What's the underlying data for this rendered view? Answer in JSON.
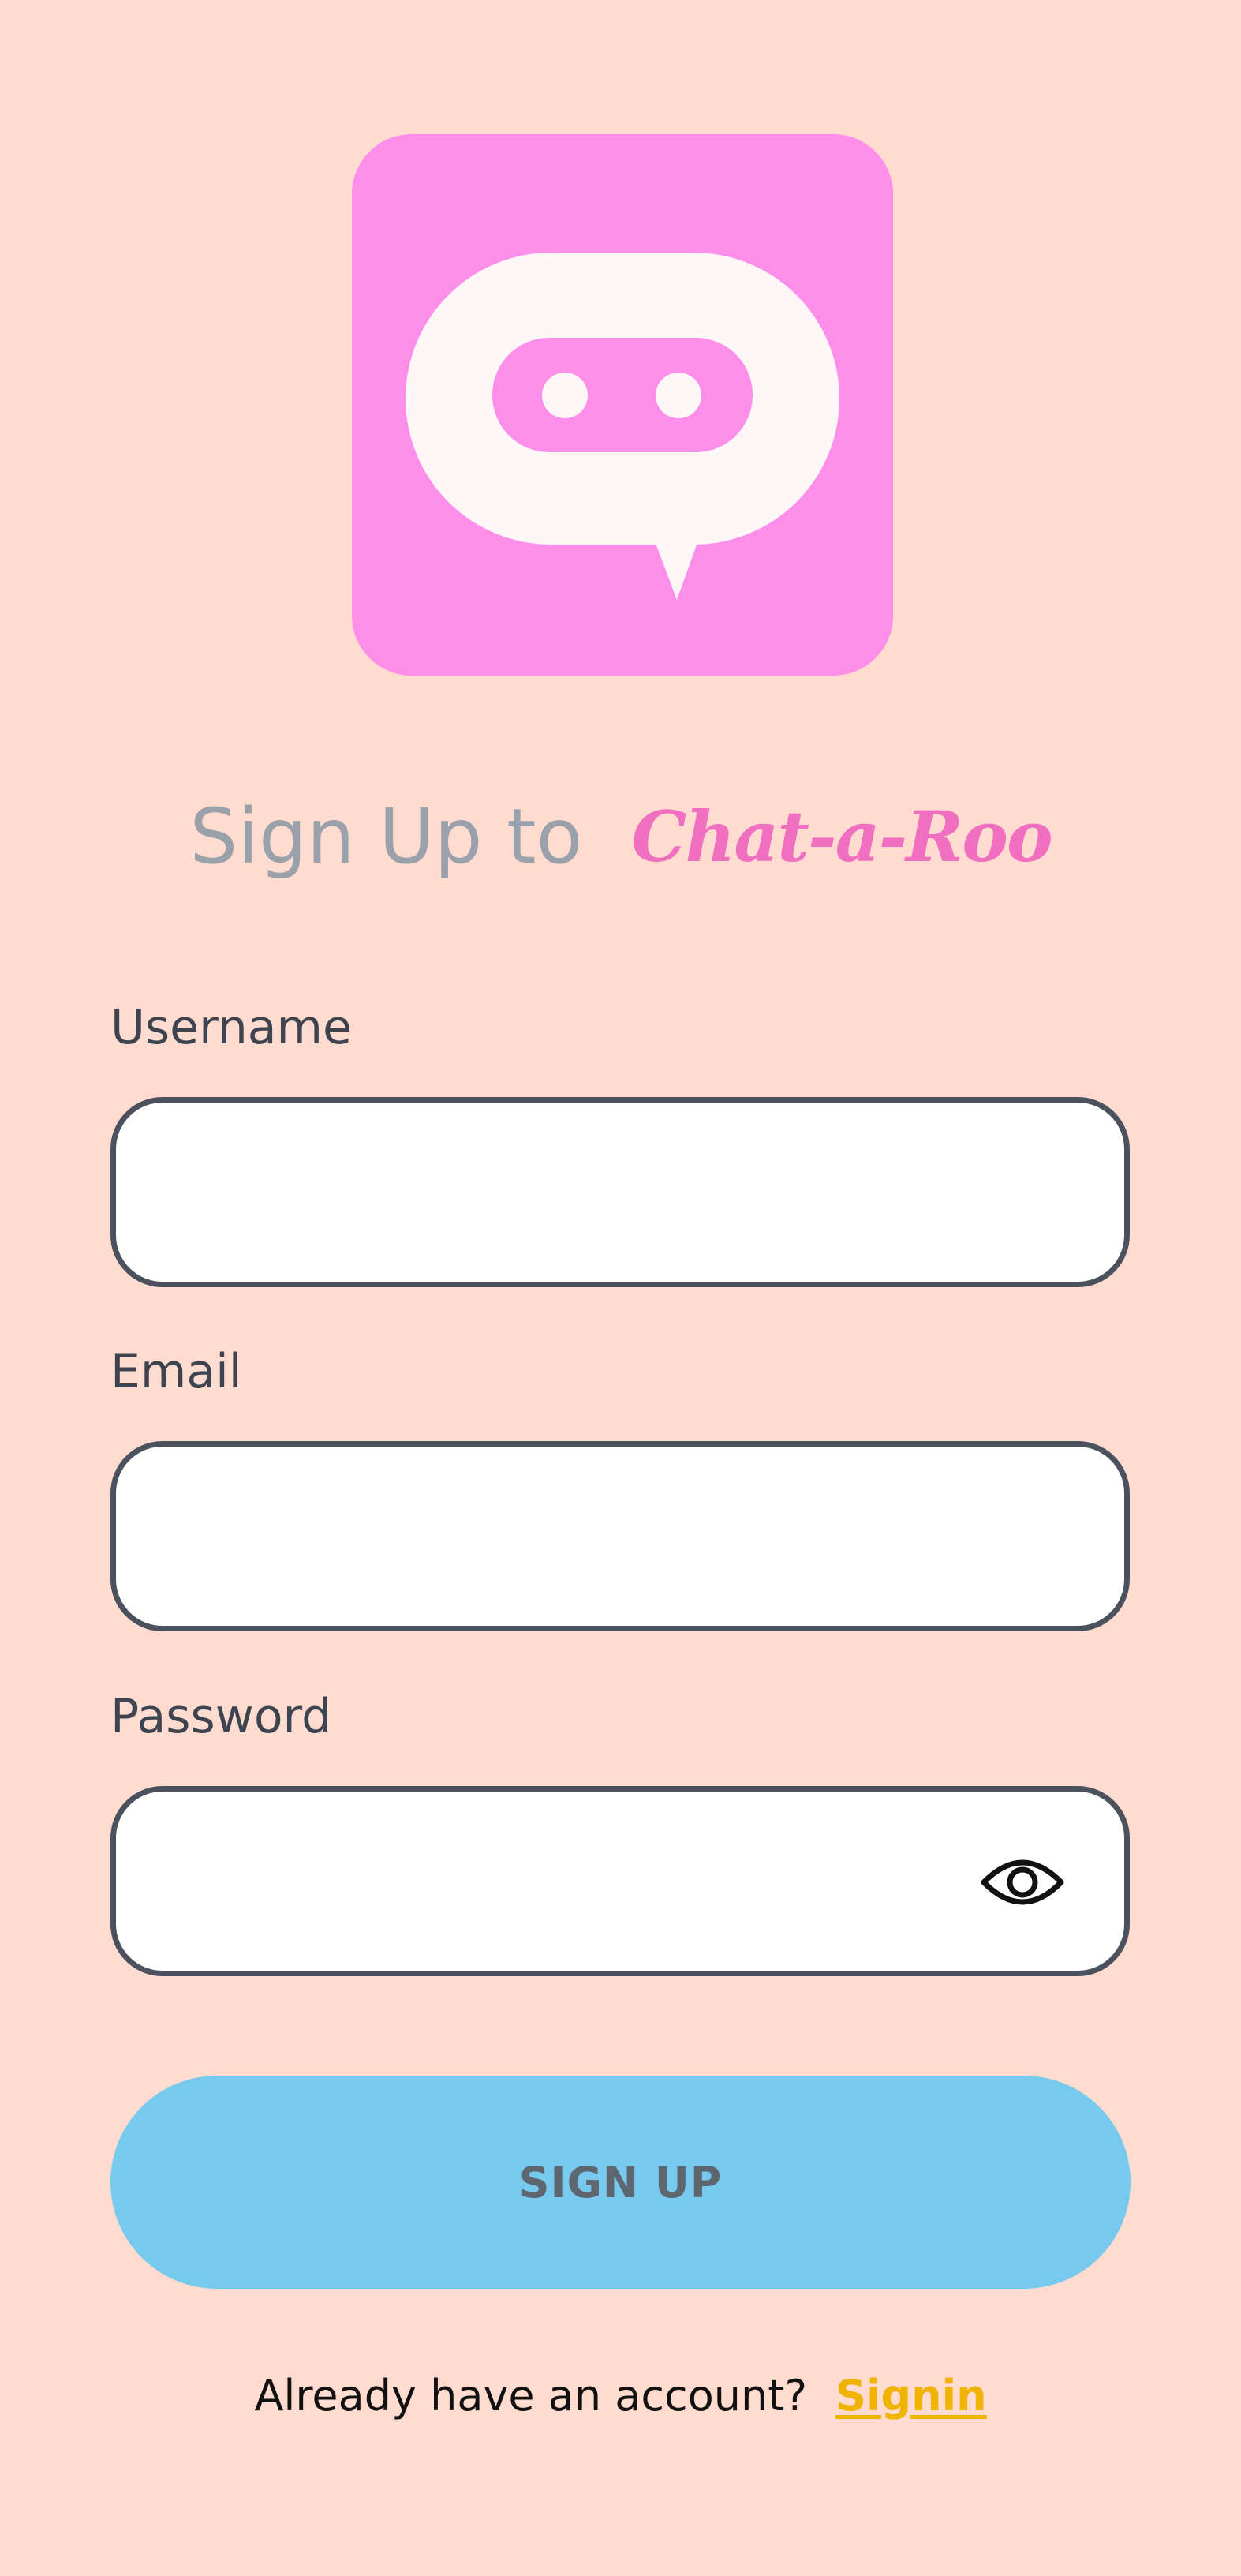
{
  "app": {
    "logo_icon": "chat-bubble-face-icon",
    "colors": {
      "background": "#FFDCCF",
      "logo_bg": "#FD8FEB",
      "brand_text": "#F16FC1",
      "button_bg": "#78C9EE",
      "link": "#F0B400",
      "field_border": "#4B515D"
    }
  },
  "header": {
    "title_lead": "Sign Up to",
    "brand_name": "Chat-a-Roo"
  },
  "form": {
    "username": {
      "label": "Username",
      "value": "",
      "placeholder": ""
    },
    "email": {
      "label": "Email",
      "value": "",
      "placeholder": ""
    },
    "password": {
      "label": "Password",
      "value": "",
      "placeholder": "",
      "toggle_icon": "eye-icon"
    },
    "submit_label": "SIGN UP"
  },
  "footer": {
    "prompt": "Already have an account?",
    "link_label": "Signin"
  }
}
